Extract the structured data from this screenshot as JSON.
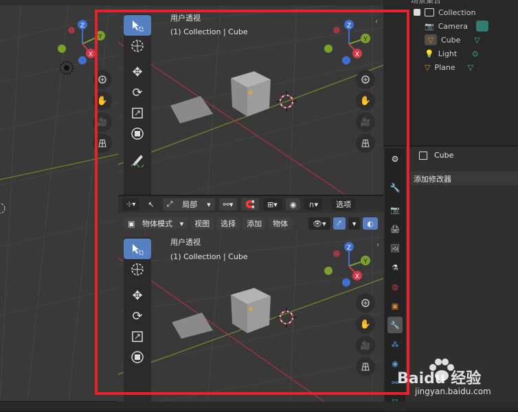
{
  "left_viewport": {},
  "top_viewport": {
    "header": {
      "mode": "物体模式",
      "menus": [
        "视图",
        "选择",
        "添加",
        "物体"
      ]
    },
    "view_name": "用户透视",
    "collection_line": "(1) Collection | Cube"
  },
  "bottom_viewport": {
    "header_row1": {
      "transform": "局部",
      "options": "选项"
    },
    "header_row2": {
      "mode": "物体模式",
      "menus": [
        "视图",
        "选择",
        "添加",
        "物体"
      ]
    },
    "view_name": "用户透视",
    "collection_line": "(1) Collection | Cube"
  },
  "outliner": {
    "scene_collection": "场景集合",
    "items": [
      {
        "label": "Collection"
      },
      {
        "label": "Camera"
      },
      {
        "label": "Cube"
      },
      {
        "label": "Light"
      },
      {
        "label": "Plane"
      }
    ]
  },
  "properties": {
    "object_name": "Cube",
    "add_modifier": "添加修改器"
  },
  "watermark": {
    "brand": "Baidu 经验",
    "url": "jingyan.baidu.com"
  },
  "colors": {
    "highlight_frame": "#e8222b",
    "accent": "#5680c2",
    "x_axis": "#d33b4a",
    "y_axis": "#7aa22b",
    "z_axis": "#3f6fd1"
  }
}
